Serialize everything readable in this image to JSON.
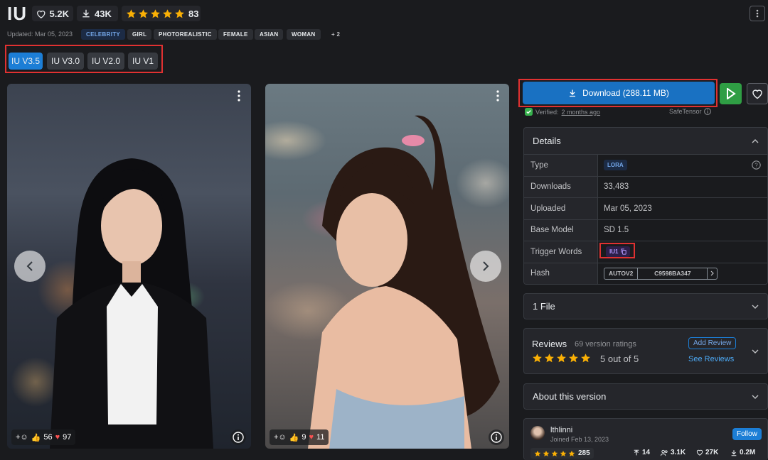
{
  "header": {
    "title": "IU",
    "likes": "5.2K",
    "downloads": "43K",
    "rating_count": "83",
    "updated": "Updated: Mar 05, 2023",
    "tags": [
      "CELEBRITY",
      "GIRL",
      "PHOTOREALISTIC",
      "FEMALE",
      "ASIAN",
      "WOMAN"
    ],
    "more_tags": "+ 2"
  },
  "versions": [
    "IU V3.5",
    "IU V3.0",
    "IU V2.0",
    "IU V1"
  ],
  "gallery": {
    "image1": {
      "likes": "56",
      "hearts": "97"
    },
    "image2": {
      "likes": "9",
      "hearts": "11"
    }
  },
  "download": {
    "label": "Download (288.11 MB)",
    "verified_prefix": "Verified:",
    "verified_when": "2 months ago",
    "format": "SafeTensor"
  },
  "details": {
    "heading": "Details",
    "rows": [
      {
        "key": "Type",
        "value": "LORA"
      },
      {
        "key": "Downloads",
        "value": "33,483"
      },
      {
        "key": "Uploaded",
        "value": "Mar 05, 2023"
      },
      {
        "key": "Base Model",
        "value": "SD 1.5"
      },
      {
        "key": "Trigger Words",
        "value": "IU1"
      },
      {
        "key": "Hash",
        "value": "C9598BA347"
      }
    ],
    "hash_type": "AUTOV2"
  },
  "files": {
    "heading": "1 File"
  },
  "reviews": {
    "heading": "Reviews",
    "ratings": "69 version ratings",
    "score": "5 out of 5",
    "add": "Add Review",
    "see": "See Reviews"
  },
  "about": {
    "heading": "About this version"
  },
  "creator": {
    "name": "lthlinni",
    "joined": "Joined Feb 13, 2023",
    "follow": "Follow",
    "rating": "285",
    "uploads": "14",
    "followers": "3.1K",
    "favorites": "27K",
    "downloads": "0.2M"
  },
  "colors": {
    "accent": "#1c7ed6",
    "star": "#fab005",
    "highlight": "#e03131",
    "run": "#2f9e44"
  }
}
